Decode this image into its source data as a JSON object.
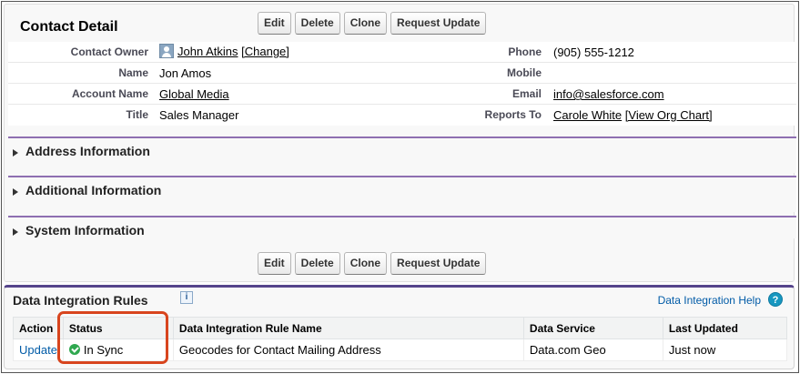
{
  "detail": {
    "title": "Contact Detail",
    "buttons": {
      "edit": "Edit",
      "delete": "Delete",
      "clone": "Clone",
      "request_update": "Request Update"
    },
    "fields": {
      "contact_owner_label": "Contact Owner",
      "contact_owner_value": "John Atkins",
      "change_link": "[Change]",
      "phone_label": "Phone",
      "phone_value": "(905) 555-1212",
      "name_label": "Name",
      "name_value": "Jon Amos",
      "mobile_label": "Mobile",
      "mobile_value": "",
      "account_name_label": "Account Name",
      "account_name_value": "Global Media",
      "email_label": "Email",
      "email_value": "info@salesforce.com",
      "title_label": "Title",
      "title_value": "Sales Manager",
      "reports_to_label": "Reports To",
      "reports_to_value": "Carole White",
      "view_org_chart": "[View Org Chart]"
    },
    "sections": {
      "address": "Address Information",
      "additional": "Additional Information",
      "system": "System Information"
    }
  },
  "integration": {
    "title": "Data Integration Rules",
    "info_icon": "i",
    "help_link": "Data Integration Help",
    "help_icon": "?",
    "columns": {
      "action": "Action",
      "status": "Status",
      "rule_name": "Data Integration Rule Name",
      "data_service": "Data Service",
      "last_updated": "Last Updated"
    },
    "rows": [
      {
        "action": "Update",
        "status": "In Sync",
        "rule_name": "Geocodes for Contact Mailing Address",
        "data_service": "Data.com Geo",
        "last_updated": "Just now"
      }
    ]
  },
  "colors": {
    "section_rule": "#8e6fb1",
    "status_ok": "#2fa84f",
    "highlight": "#d8451e",
    "link": "#015ba7"
  }
}
